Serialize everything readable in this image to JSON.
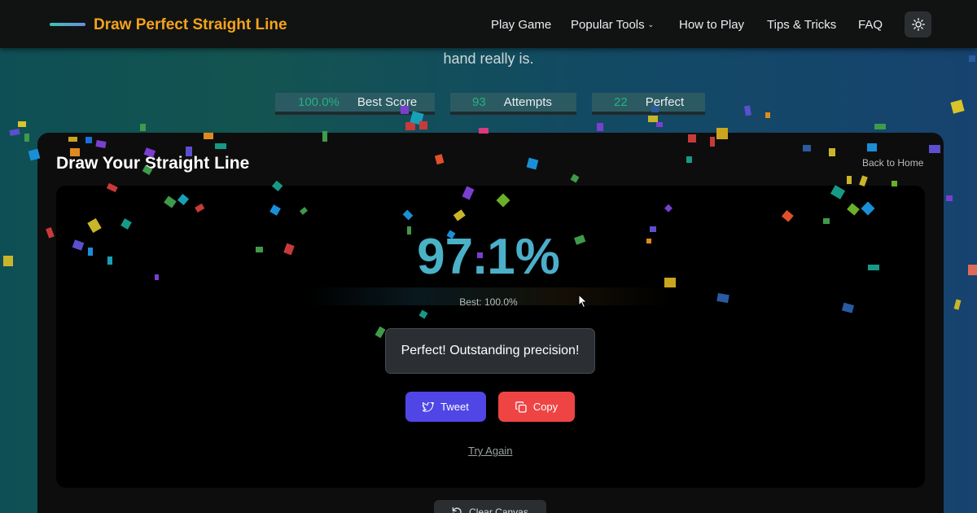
{
  "header": {
    "logo_text": "Draw Perfect Straight Line",
    "nav": {
      "play_game": "Play Game",
      "popular_tools": "Popular Tools",
      "how_to_play": "How to Play",
      "tips_tricks": "Tips & Tricks",
      "faq": "FAQ"
    },
    "theme_toggle_icon": "sun-icon"
  },
  "intro": {
    "tail_text": "hand really is."
  },
  "stats": [
    {
      "value": "100.0%",
      "label": "Best Score"
    },
    {
      "value": "93",
      "label": "Attempts"
    },
    {
      "value": "22",
      "label": "Perfect"
    }
  ],
  "panel": {
    "title": "Draw Your Straight Line",
    "back_link": "Back to Home",
    "score": "97.1%",
    "best": "Best: 100.0%",
    "message": "Perfect! Outstanding precision!",
    "tweet_label": "Tweet",
    "copy_label": "Copy",
    "try_again": "Try Again",
    "clear_label": "Clear Canvas"
  },
  "colors": {
    "accent_orange": "#f5a31a",
    "stat_green": "#1fb37f",
    "tweet_purple": "#4f46e5",
    "copy_red": "#ef4444"
  }
}
